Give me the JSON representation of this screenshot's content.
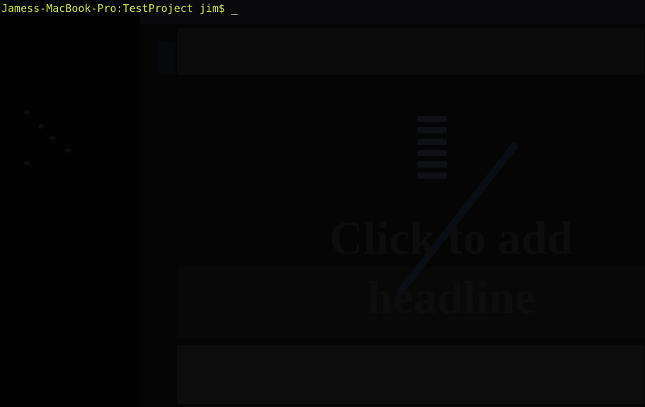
{
  "terminal": {
    "prompt": "Jamess-MacBook-Pro:TestProject jim$",
    "cursor": "_",
    "colors": {
      "background": "#020202",
      "prompt_text": "#cde94a",
      "cursor": "#ffffff"
    }
  },
  "background_window": {
    "headline_placeholder": "Click to add headline"
  }
}
